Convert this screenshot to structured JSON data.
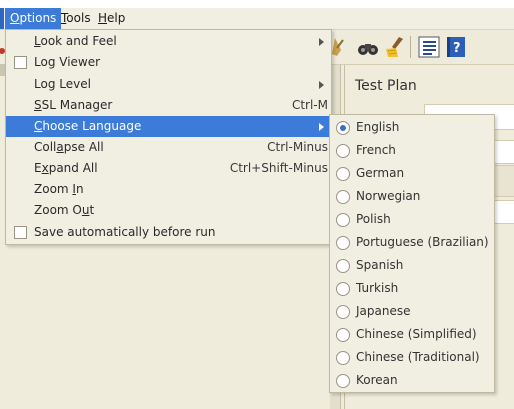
{
  "menubar": {
    "items": [
      {
        "label": "Options",
        "mnemonic": "O",
        "rest": "ptions"
      },
      {
        "label": "Tools",
        "mnemonic": "T",
        "rest": "ools"
      },
      {
        "label": "Help",
        "mnemonic": "H",
        "rest": "elp"
      }
    ]
  },
  "options_menu": {
    "items": [
      {
        "pre": "",
        "mn": "L",
        "post": "ook and Feel",
        "accel": ""
      },
      {
        "pre": "Log Viewer",
        "mn": "",
        "post": "",
        "accel": ""
      },
      {
        "pre": "Log Level",
        "mn": "",
        "post": "",
        "accel": ""
      },
      {
        "pre": "",
        "mn": "S",
        "post": "SL Manager",
        "accel": "Ctrl-M"
      },
      {
        "pre": "",
        "mn": "C",
        "post": "hoose Language",
        "accel": ""
      },
      {
        "pre": "Coll",
        "mn": "a",
        "post": "pse All",
        "accel": "Ctrl-Minus"
      },
      {
        "pre": "E",
        "mn": "x",
        "post": "pand All",
        "accel": "Ctrl+Shift-Minus"
      },
      {
        "pre": "Zoom ",
        "mn": "I",
        "post": "n",
        "accel": ""
      },
      {
        "pre": "Zoom O",
        "mn": "u",
        "post": "t",
        "accel": ""
      },
      {
        "pre": "Save automatically before run",
        "mn": "",
        "post": "",
        "accel": ""
      }
    ]
  },
  "language_menu": {
    "selected": "English",
    "items": [
      "English",
      "French",
      "German",
      "Norwegian",
      "Polish",
      "Portuguese (Brazilian)",
      "Spanish",
      "Turkish",
      "Japanese",
      "Chinese (Simplified)",
      "Chinese (Traditional)",
      "Korean"
    ]
  },
  "panel": {
    "title": "Test Plan"
  },
  "colors": {
    "highlight": "#3c7bd8",
    "menu_bg": "#f1eee2",
    "app_bg": "#f0ecdc"
  },
  "icons": [
    "broom-icon",
    "binoculars-icon",
    "clear-all-icon",
    "list-icon",
    "help-book-icon"
  ]
}
